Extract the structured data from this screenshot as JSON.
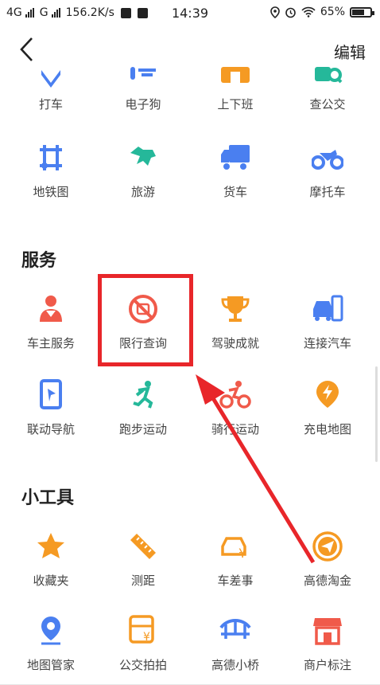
{
  "status_bar": {
    "network1": "4G",
    "network2": "G",
    "speed": "156.2K/s",
    "time": "14:39",
    "battery": "65%"
  },
  "header": {
    "edit_label": "编辑"
  },
  "top_items": [
    {
      "label": "打车",
      "icon": "taxi-icon"
    },
    {
      "label": "电子狗",
      "icon": "e-dog-icon"
    },
    {
      "label": "上下班",
      "icon": "commute-icon"
    },
    {
      "label": "查公交",
      "icon": "bus-search-icon"
    },
    {
      "label": "地铁图",
      "icon": "subway-map-icon"
    },
    {
      "label": "旅游",
      "icon": "travel-horse-icon"
    },
    {
      "label": "货车",
      "icon": "truck-icon"
    },
    {
      "label": "摩托车",
      "icon": "motorcycle-icon"
    }
  ],
  "services": {
    "title": "服务",
    "items": [
      {
        "label": "车主服务",
        "icon": "car-owner-icon"
      },
      {
        "label": "限行查询",
        "icon": "restriction-icon"
      },
      {
        "label": "驾驶成就",
        "icon": "trophy-icon"
      },
      {
        "label": "连接汽车",
        "icon": "connect-car-icon"
      },
      {
        "label": "联动导航",
        "icon": "linked-nav-icon"
      },
      {
        "label": "跑步运动",
        "icon": "running-icon"
      },
      {
        "label": "骑行运动",
        "icon": "cycling-icon"
      },
      {
        "label": "充电地图",
        "icon": "charging-map-icon"
      }
    ]
  },
  "tools": {
    "title": "小工具",
    "items": [
      {
        "label": "收藏夹",
        "icon": "star-icon"
      },
      {
        "label": "测距",
        "icon": "ruler-icon"
      },
      {
        "label": "车差事",
        "icon": "car-errand-icon"
      },
      {
        "label": "高德淘金",
        "icon": "gold-icon"
      },
      {
        "label": "地图管家",
        "icon": "map-pin-icon"
      },
      {
        "label": "公交拍拍",
        "icon": "bus-photo-icon"
      },
      {
        "label": "高德小桥",
        "icon": "bridge-icon"
      },
      {
        "label": "商户标注",
        "icon": "shop-icon"
      }
    ]
  },
  "colors": {
    "blue": "#4a7ff0",
    "orange": "#f59a23",
    "green": "#25b89a",
    "red": "#f05a4a",
    "highlight": "#e8262a"
  }
}
